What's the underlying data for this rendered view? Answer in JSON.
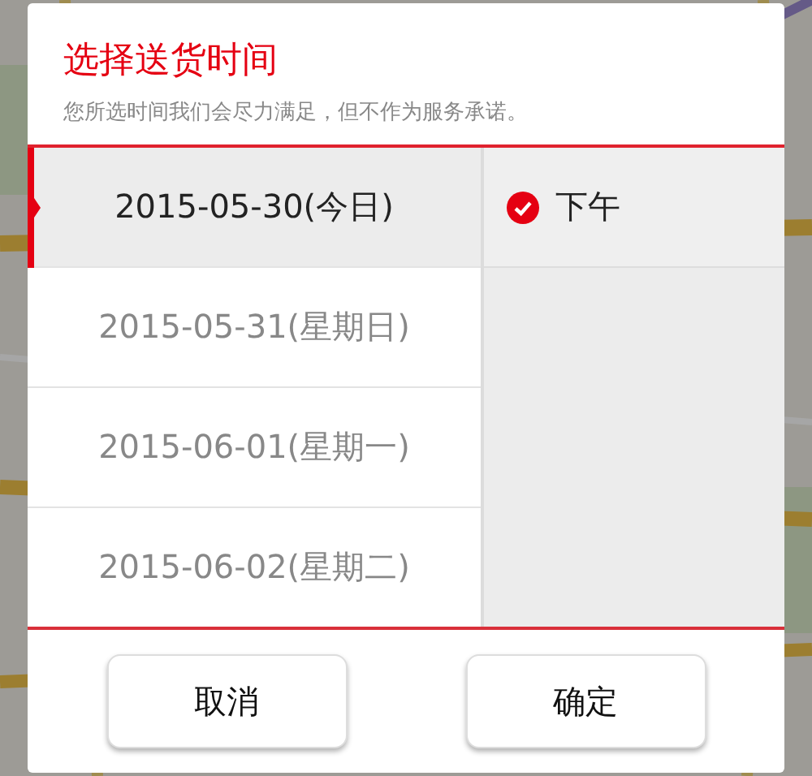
{
  "dialog": {
    "title": "选择送货时间",
    "subtitle": "您所选时间我们会尽力满足，但不作为服务承诺。",
    "dates": [
      {
        "label": "2015-05-30(今日)",
        "selected": true
      },
      {
        "label": "2015-05-31(星期日)",
        "selected": false
      },
      {
        "label": "2015-06-01(星期一)",
        "selected": false
      },
      {
        "label": "2015-06-02(星期二)",
        "selected": false
      }
    ],
    "time_slots": [
      {
        "label": "下午",
        "selected": true
      }
    ],
    "buttons": [
      "取消",
      "确定"
    ]
  }
}
